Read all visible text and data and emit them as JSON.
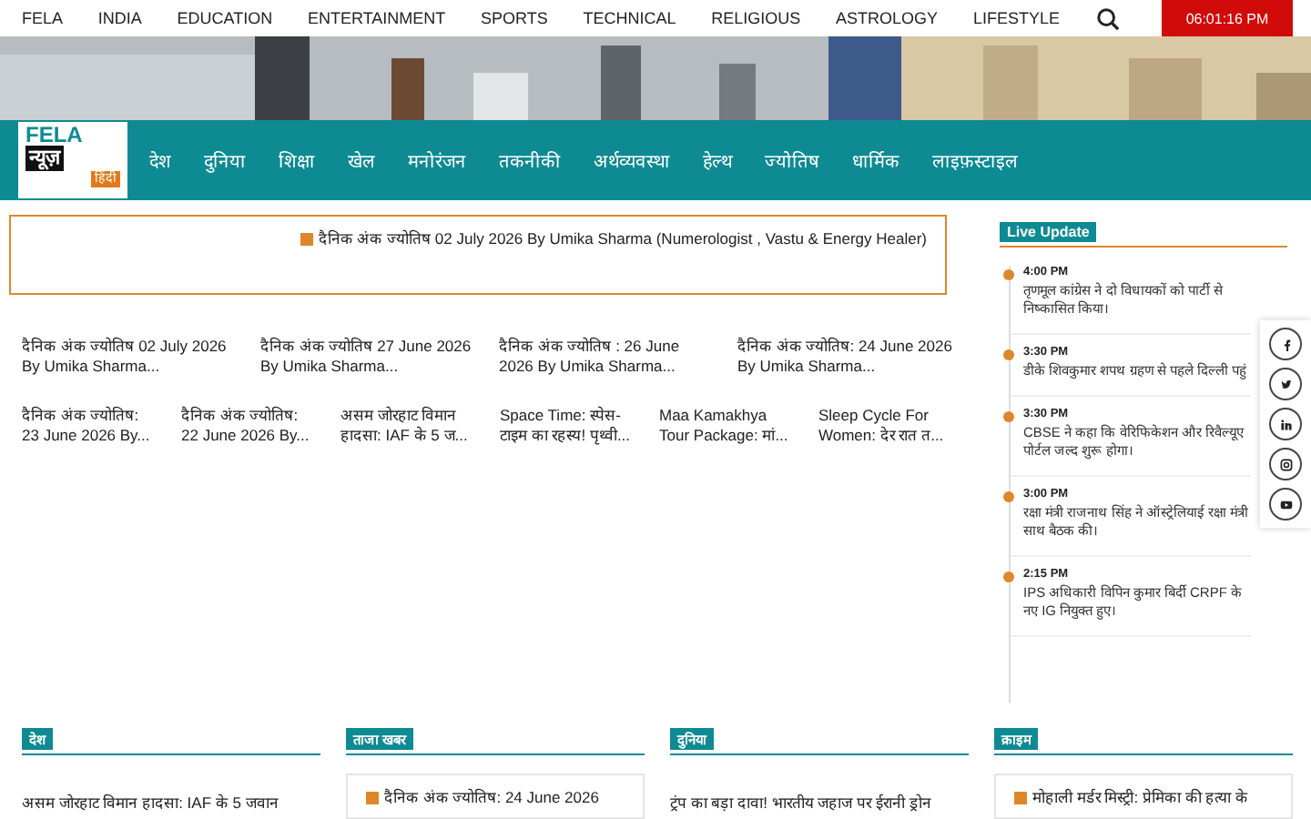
{
  "top_menu": [
    "FELA",
    "INDIA",
    "EDUCATION",
    "ENTERTAINMENT",
    "SPORTS",
    "TECHNICAL",
    "RELIGIOUS",
    "ASTROLOGY",
    "LIFESTYLE"
  ],
  "clock": "06:01:16 PM",
  "logo": {
    "line1": "FELA",
    "line2": "न्यूज़",
    "badge": "हिंदी"
  },
  "nav": [
    "देश",
    "दुनिया",
    "शिक्षा",
    "खेल",
    "मनोरंजन",
    "तकनीकी",
    "अर्थव्यवस्था",
    "हेल्थ",
    "ज्योतिष",
    "धार्मिक",
    "लाइफ़स्टाइल"
  ],
  "ticker": "दैनिक अंक ज्योतिष 02 July 2026 By Umika Sharma (Numerologist , Vastu & Energy Healer)",
  "stories_row1": [
    {
      "line1": "दैनिक अंक ज्योतिष 02 July 2026",
      "line2": "By Umika Sharma..."
    },
    {
      "line1": "दैनिक अंक ज्योतिष 27 June 2026",
      "line2": "By Umika Sharma..."
    },
    {
      "line1": "दैनिक अंक ज्योतिष : 26 June",
      "line2": "2026 By Umika Sharma..."
    },
    {
      "line1": "दैनिक अंक ज्योतिष: 24 June 2026",
      "line2": "By Umika Sharma..."
    }
  ],
  "stories_row2": [
    {
      "line1": "दैनिक अंक ज्योतिष:",
      "line2": "23 June 2026 By..."
    },
    {
      "line1": "दैनिक अंक ज्योतिष:",
      "line2": "22 June 2026 By..."
    },
    {
      "line1": "असम जोरहाट विमान",
      "line2": "हादसा: IAF के 5 ज..."
    },
    {
      "line1": "Space Time: स्पेस-",
      "line2": "टाइम का रहस्य! पृथ्वी..."
    },
    {
      "line1": "Maa Kamakhya",
      "line2": "Tour Package: मां..."
    },
    {
      "line1": "Sleep Cycle For",
      "line2": "Women: देर रात त..."
    }
  ],
  "live_update": {
    "title": "Live Update",
    "items": [
      {
        "time": "4:00 PM",
        "text": "तृणमूल कांग्रेस ने दो विधायकों को पार्टी से निष्कासित किया।"
      },
      {
        "time": "3:30 PM",
        "text": "डीके शिवकुमार शपथ ग्रहण से पहले दिल्ली पहुं"
      },
      {
        "time": "3:30 PM",
        "text": "CBSE ने कहा कि वेरिफिकेशन और रिवैल्यूए पोर्टल जल्द शुरू होगा।"
      },
      {
        "time": "3:00 PM",
        "text": "रक्षा मंत्री राजनाथ सिंह ने ऑस्ट्रेलियाई रक्षा मंत्री साथ बैठक की।"
      },
      {
        "time": "2:15 PM",
        "text": "IPS अधिकारी विपिन कुमार बिर्दी CRPF के नए IG नियुक्त हुए।"
      }
    ]
  },
  "social": [
    {
      "kind": "facebook"
    },
    {
      "kind": "twitter"
    },
    {
      "kind": "linkedin"
    },
    {
      "kind": "instagram"
    },
    {
      "kind": "youtube"
    }
  ],
  "sections": [
    {
      "title": "देश",
      "boxed": false,
      "headline": "असम जोरहाट विमान हादसा: IAF के 5 जवान"
    },
    {
      "title": "ताजा खबर",
      "boxed": true,
      "headline": "दैनिक अंक ज्योतिष: 24 June 2026"
    },
    {
      "title": "दुनिया",
      "boxed": false,
      "headline": "ट्रंप का बड़ा दावा! भारतीय जहाज पर ईरानी ड्रोन"
    },
    {
      "title": "क्राइम",
      "boxed": true,
      "headline": "मोहाली मर्डर मिस्ट्री: प्रेमिका की हत्या के"
    }
  ]
}
